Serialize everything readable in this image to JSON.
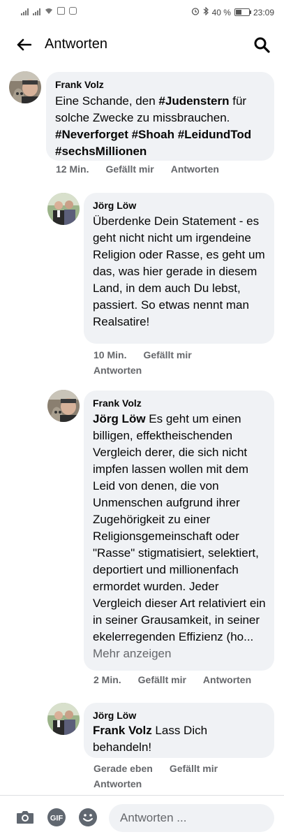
{
  "status_bar": {
    "battery_text": "40 %",
    "time": "23:09"
  },
  "header": {
    "title": "Antworten"
  },
  "comments": [
    {
      "author": "Frank Volz",
      "text_1": "Eine Schande, den ",
      "hashtag_1": "#Judenstern",
      "text_2": " für solche Zwecke zu missbrauchen. ",
      "hashtags": "#Neverforget #Shoah #LeidundTod #sechsMillionen",
      "time": "12 Min.",
      "like": "Gefällt mir",
      "reply": "Antworten"
    },
    {
      "author": "Jörg Löw",
      "text": "Überdenke  Dein Statement - es geht nicht nicht um irgendeine Religion oder Rasse, es geht um das, was hier gerade in diesem Land, in dem auch Du lebst, passiert. So etwas nennt man Realsatire!",
      "time": "10 Min.",
      "like": "Gefällt mir",
      "reply": "Antworten"
    },
    {
      "author": "Frank Volz",
      "mention": "Jörg Löw",
      "text": " Es geht um einen billigen, effektheischenden Vergleich derer, die sich nicht impfen lassen wollen mit dem Leid von denen, die von Unmenschen aufgrund ihrer Zugehörigkeit zu einer Religionsgemeinschaft oder \"Rasse\" stigmatisiert, selektiert, deportiert und millionenfach ermordet wurden. Jeder Vergleich dieser Art relativiert ein in seiner Grausamkeit, in seiner ekelerregenden Effizienz (ho...",
      "more": "Mehr anzeigen",
      "time": "2 Min.",
      "like": "Gefällt mir",
      "reply": "Antworten"
    },
    {
      "author": "Jörg Löw",
      "mention": "Frank Volz",
      "text": " Lass Dich behandeln!",
      "time": "Gerade eben",
      "like": "Gefällt mir",
      "reply": "Antworten"
    }
  ],
  "composer": {
    "placeholder": "Antworten ...",
    "gif_label": "GIF"
  },
  "colors": {
    "bubble": "#f0f2f5",
    "secondary_text": "#65676b",
    "icon": "#606770"
  },
  "icons": [
    "back-arrow-icon",
    "search-icon",
    "camera-icon",
    "gif-icon",
    "emoji-icon"
  ]
}
